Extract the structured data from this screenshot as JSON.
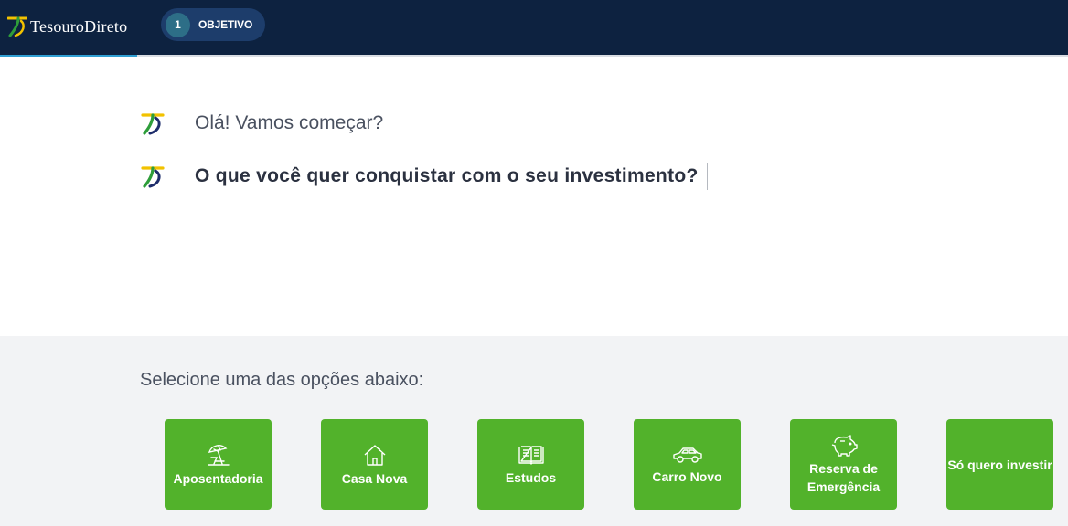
{
  "header": {
    "brand": "TesouroDireto",
    "step": {
      "number": "1",
      "label": "OBJETIVO"
    },
    "progress_fraction": 0.128
  },
  "chat": {
    "messages": [
      {
        "text": "Olá! Vamos começar?"
      },
      {
        "text": "O que você quer conquistar com o seu investimento?"
      }
    ]
  },
  "options": {
    "prompt": "Selecione uma das opções abaixo:",
    "items": [
      {
        "label": "Aposentadoria",
        "icon": "beach-umbrella-icon"
      },
      {
        "label": "Casa Nova",
        "icon": "house-icon"
      },
      {
        "label": "Estudos",
        "icon": "book-icon"
      },
      {
        "label": "Carro Novo",
        "icon": "car-icon"
      },
      {
        "label": "Reserva de Emergência",
        "icon": "piggy-bank-icon"
      },
      {
        "label": "Só quero investir",
        "icon": ""
      }
    ]
  },
  "colors": {
    "header_bg": "#0d2240",
    "accent_blue": "#2f9fd3",
    "option_green": "#52b22b",
    "logo_yellow": "#f2c200",
    "logo_green": "#2e9d3a",
    "logo_navy": "#1e2d6b"
  }
}
